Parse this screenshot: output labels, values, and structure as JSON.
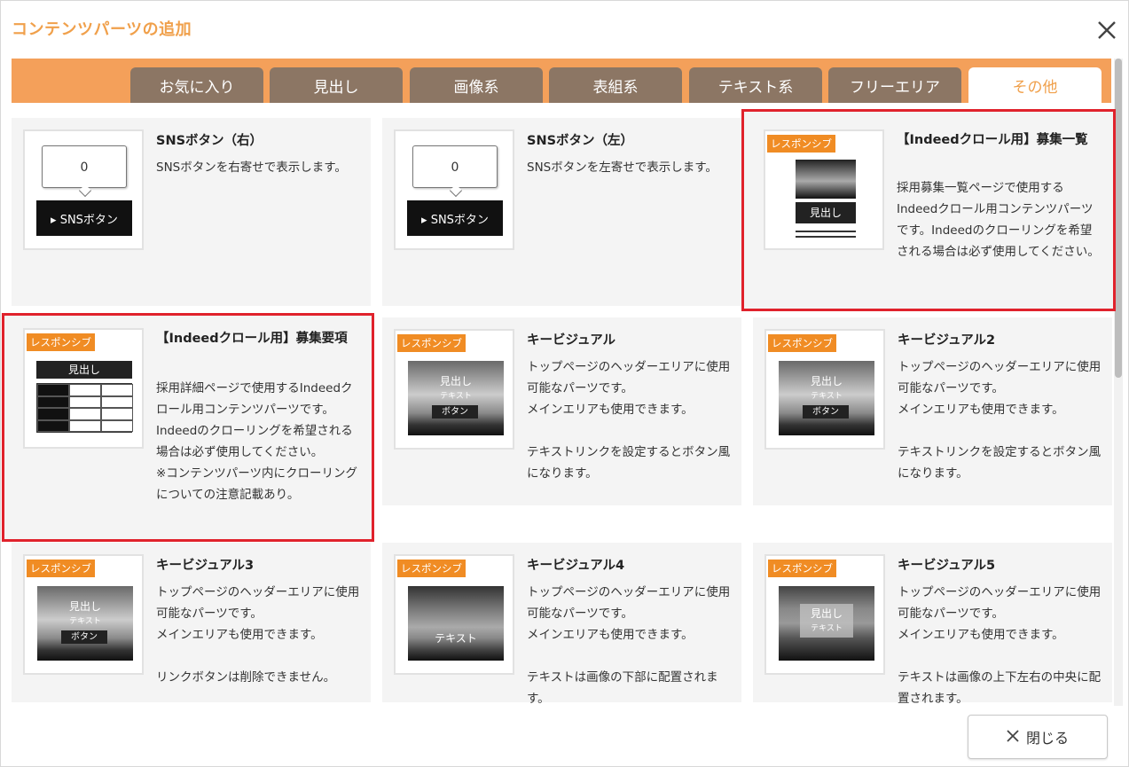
{
  "dialog": {
    "title": "コンテンツパーツの追加",
    "close_label": "閉じる"
  },
  "tabs": [
    {
      "label": "お気に入り",
      "active": false
    },
    {
      "label": "見出し",
      "active": false
    },
    {
      "label": "画像系",
      "active": false
    },
    {
      "label": "表組系",
      "active": false
    },
    {
      "label": "テキスト系",
      "active": false
    },
    {
      "label": "フリーエリア",
      "active": false
    },
    {
      "label": "その他",
      "active": true
    }
  ],
  "badge_text": "レスポンシブ",
  "cards": [
    {
      "title": "SNSボタン（右）",
      "desc": "SNSボタンを右寄せで表示します。",
      "responsive": false,
      "selected": false,
      "thumb": {
        "count": "0",
        "button": "▸ SNSボタン"
      }
    },
    {
      "title": "SNSボタン（左）",
      "desc": "SNSボタンを左寄せで表示します。",
      "responsive": false,
      "selected": false,
      "thumb": {
        "count": "0",
        "button": "▸ SNSボタン"
      }
    },
    {
      "title": "【Indeedクロール用】募集一覧",
      "desc": "採用募集一覧ページで使用するIndeedクロール用コンテンツパーツです。Indeedのクローリングを希望される場合は必ず使用してください。",
      "responsive": true,
      "selected": true,
      "thumb": {
        "heading": "見出し"
      }
    },
    {
      "title": "【Indeedクロール用】募集要項",
      "desc": "採用詳細ページで使用するIndeedクロール用コンテンツパーツです。Indeedのクローリングを希望される場合は必ず使用してください。\n※コンテンツパーツ内にクローリングについての注意記載あり。",
      "responsive": true,
      "selected": true,
      "thumb": {
        "heading": "見出し"
      }
    },
    {
      "title": "キービジュアル",
      "desc": "トップページのヘッダーエリアに使用可能なパーツです。\nメインエリアも使用できます。\n\nテキストリンクを設定するとボタン風になります。",
      "responsive": true,
      "selected": false,
      "thumb": {
        "heading": "見出し",
        "text": "テキスト",
        "button": "ボタン"
      }
    },
    {
      "title": "キービジュアル2",
      "desc": "トップページのヘッダーエリアに使用可能なパーツです。\nメインエリアも使用できます。\n\nテキストリンクを設定するとボタン風になります。",
      "responsive": true,
      "selected": false,
      "thumb": {
        "heading": "見出し",
        "text": "テキスト",
        "button": "ボタン"
      }
    },
    {
      "title": "キービジュアル3",
      "desc": "トップページのヘッダーエリアに使用可能なパーツです。\nメインエリアも使用できます。\n\nリンクボタンは削除できません。",
      "responsive": true,
      "selected": false,
      "thumb": {
        "heading": "見出し",
        "text": "テキスト",
        "button": "ボタン"
      }
    },
    {
      "title": "キービジュアル4",
      "desc": "トップページのヘッダーエリアに使用可能なパーツです。\nメインエリアも使用できます。\n\nテキストは画像の下部に配置されます。",
      "responsive": true,
      "selected": false,
      "thumb": {
        "text": "テキスト"
      }
    },
    {
      "title": "キービジュアル5",
      "desc": "トップページのヘッダーエリアに使用可能なパーツです。\nメインエリアも使用できます。\n\nテキストは画像の上下左右の中央に配置されます。",
      "responsive": true,
      "selected": false,
      "thumb": {
        "heading": "見出し",
        "text": "テキスト"
      }
    }
  ],
  "colors": {
    "accent": "#f4a05a",
    "tab_bg": "#8c7664",
    "badge": "#f08c24",
    "selection": "#e0222c",
    "title": "#f0a04b"
  },
  "icons": {
    "close": "close-icon",
    "close_button": "x-icon"
  }
}
